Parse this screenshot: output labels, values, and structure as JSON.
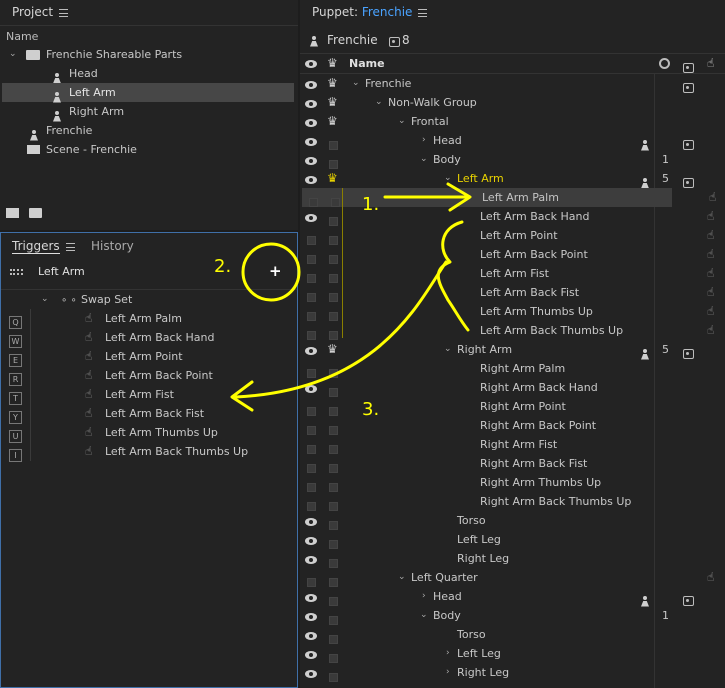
{
  "project": {
    "title": "Project",
    "col_name": "Name",
    "items": [
      {
        "label": "Frenchie Shareable Parts"
      },
      {
        "label": "Head"
      },
      {
        "label": "Left Arm"
      },
      {
        "label": "Right Arm"
      },
      {
        "label": "Frenchie"
      },
      {
        "label": "Scene - Frenchie"
      }
    ]
  },
  "triggers": {
    "tab_triggers": "Triggers",
    "tab_history": "History",
    "selected": "Left Arm",
    "swap_set": "Swap Set",
    "items": [
      {
        "key": "Q",
        "label": "Left Arm Palm"
      },
      {
        "key": "W",
        "label": "Left Arm Back Hand"
      },
      {
        "key": "E",
        "label": "Left Arm Point"
      },
      {
        "key": "R",
        "label": "Left Arm Back Point"
      },
      {
        "key": "T",
        "label": "Left Arm Fist"
      },
      {
        "key": "Y",
        "label": "Left Arm Back Fist"
      },
      {
        "key": "U",
        "label": "Left Arm Thumbs Up"
      },
      {
        "key": "I",
        "label": "Left Arm Back Thumbs Up"
      }
    ]
  },
  "puppet": {
    "title_prefix": "Puppet:",
    "title_name": "Frenchie",
    "sub_name": "Frenchie",
    "sub_count": "8",
    "col_name": "Name",
    "rows": [
      {
        "label": "Frenchie",
        "num": ""
      },
      {
        "label": "Non-Walk Group",
        "num": ""
      },
      {
        "label": "Frontal",
        "num": ""
      },
      {
        "label": "Head",
        "num": ""
      },
      {
        "label": "Body",
        "num": "1"
      },
      {
        "label": "Left Arm",
        "num": "5"
      },
      {
        "label": "Left Arm Palm",
        "num": ""
      },
      {
        "label": "Left Arm Back Hand",
        "num": ""
      },
      {
        "label": "Left Arm Point",
        "num": ""
      },
      {
        "label": "Left Arm Back Point",
        "num": ""
      },
      {
        "label": "Left Arm Fist",
        "num": ""
      },
      {
        "label": "Left Arm Back Fist",
        "num": ""
      },
      {
        "label": "Left Arm Thumbs Up",
        "num": ""
      },
      {
        "label": "Left Arm Back Thumbs Up",
        "num": ""
      },
      {
        "label": "Right Arm",
        "num": "5"
      },
      {
        "label": "Right Arm Palm",
        "num": ""
      },
      {
        "label": "Right Arm Back Hand",
        "num": ""
      },
      {
        "label": "Right Arm Point",
        "num": ""
      },
      {
        "label": "Right Arm Back Point",
        "num": ""
      },
      {
        "label": "Right Arm Fist",
        "num": ""
      },
      {
        "label": "Right Arm Back Fist",
        "num": ""
      },
      {
        "label": "Right Arm Thumbs Up",
        "num": ""
      },
      {
        "label": "Right Arm Back Thumbs Up",
        "num": ""
      },
      {
        "label": "Torso",
        "num": ""
      },
      {
        "label": "Left Leg",
        "num": ""
      },
      {
        "label": "Right Leg",
        "num": ""
      },
      {
        "label": "Left Quarter",
        "num": ""
      },
      {
        "label": "Head",
        "num": ""
      },
      {
        "label": "Body",
        "num": "1"
      },
      {
        "label": "Torso",
        "num": ""
      },
      {
        "label": "Left Leg",
        "num": ""
      },
      {
        "label": "Right Leg",
        "num": ""
      }
    ]
  },
  "annotations": {
    "a1": "1.",
    "a2": "2.",
    "a3": "3."
  },
  "colors": {
    "accent_blue": "#4aa3ff",
    "highlight_yellow": "#ffff00",
    "selected_row": "#3d3d3d"
  }
}
